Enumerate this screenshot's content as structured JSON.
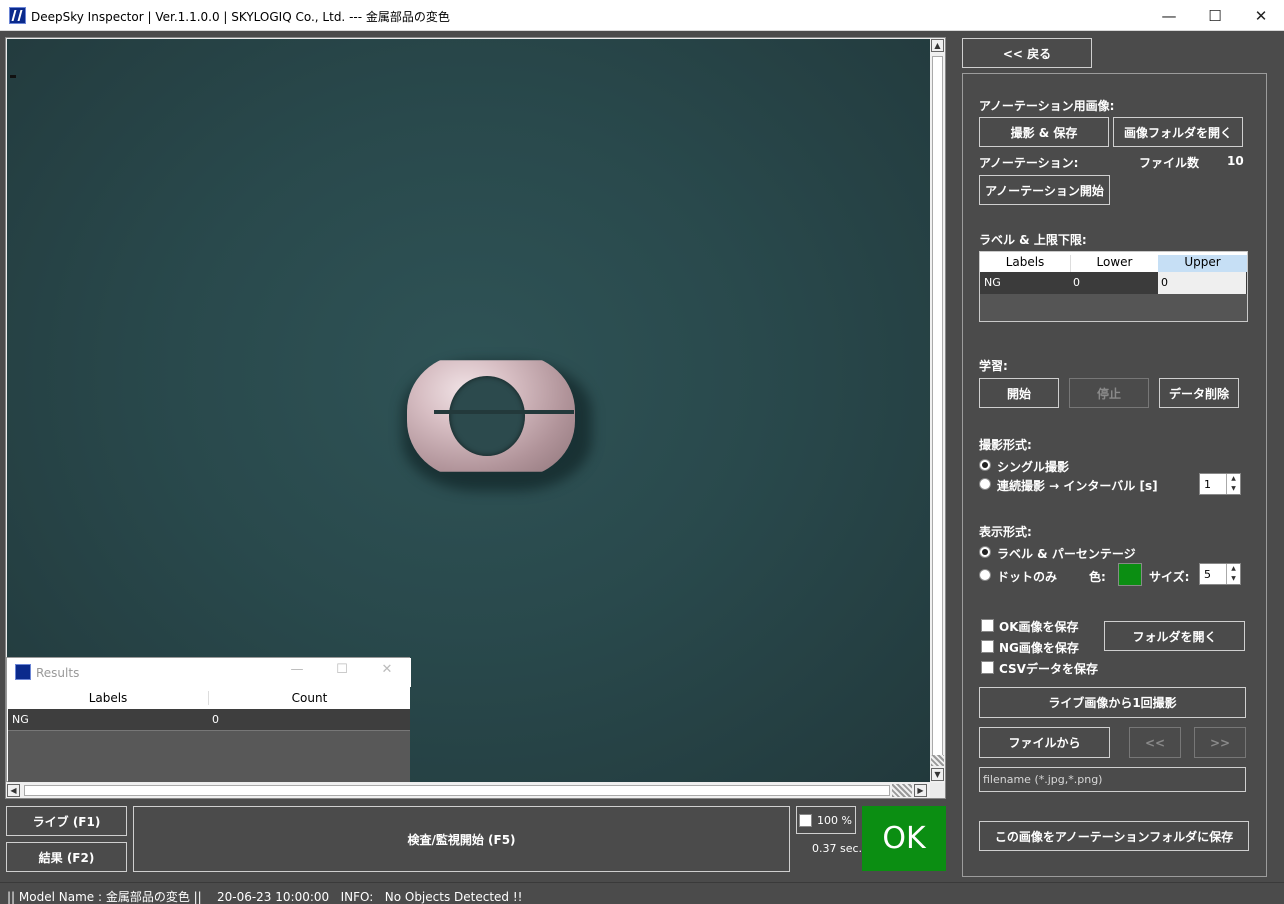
{
  "window": {
    "title": "DeepSky Inspector | Ver.1.1.0.0 | SKYLOGIQ Co., Ltd. --- 金属部品の変色",
    "min_symbol": "—",
    "max_symbol": "☐",
    "close_symbol": "✕"
  },
  "results_window": {
    "title": "Results",
    "min_symbol": "—",
    "max_symbol": "☐",
    "close_symbol": "✕",
    "columns": [
      "Labels",
      "Count"
    ],
    "rows": [
      {
        "label": "NG",
        "count": "0"
      }
    ]
  },
  "bottom": {
    "live_button": "ライブ (F1)",
    "result_button": "結果 (F2)",
    "inspect_button": "検査/監視開始 (F5)",
    "zoom_label": "100 %",
    "zoom_checked": false,
    "elapsed": "0.37 sec.",
    "verdict": "OK",
    "verdict_color": "#0b8e12"
  },
  "status_bar": {
    "text": "|| Model Name : 金属部品の変色 ||    20-06-23 10:00:00   INFO:   No Objects Detected !!"
  },
  "right_panel": {
    "back_button": "<< 戻る",
    "annotation_images_label": "アノーテーション用画像:",
    "capture_save_button": "撮影 & 保存",
    "open_image_folder_button": "画像フォルダを開く",
    "annotation_label": "アノーテーション:",
    "file_count_label": "ファイル数",
    "file_count_value": "10",
    "annotation_start_button": "アノーテーション開始",
    "label_limits_label": "ラベル & 上限下限:",
    "limits_table": {
      "columns": [
        "Labels",
        "Lower",
        "Upper"
      ],
      "rows": [
        {
          "label": "NG",
          "lower": "0",
          "upper": "0"
        }
      ]
    },
    "learning_label": "学習:",
    "learn_start_button": "開始",
    "learn_stop_button": "停止",
    "data_delete_button": "データ削除",
    "capture_mode_label": "撮影形式:",
    "capture_single_option": "シングル撮影",
    "capture_continuous_option": "連続撮影 → インターバル [s]",
    "capture_mode_selected": "single",
    "interval_value": "1",
    "display_mode_label": "表示形式:",
    "display_label_percent_option": "ラベル & パーセンテージ",
    "display_dot_option": "ドットのみ",
    "display_mode_selected": "label_percent",
    "color_label": "色:",
    "dot_color": "#0b8e12",
    "size_label": "サイズ:",
    "size_value": "5",
    "save_ok_images": "OK画像を保存",
    "save_ng_images": "NG画像を保存",
    "save_csv": "CSVデータを保存",
    "open_folder_button": "フォルダを開く",
    "capture_from_live_button": "ライブ画像から1回撮影",
    "from_file_button": "ファイルから",
    "prev_button": "<<",
    "next_button": ">>",
    "filename_placeholder": "filename (*.jpg,*.png)",
    "save_to_annotation_button": "この画像をアノーテーションフォルダに保存"
  }
}
